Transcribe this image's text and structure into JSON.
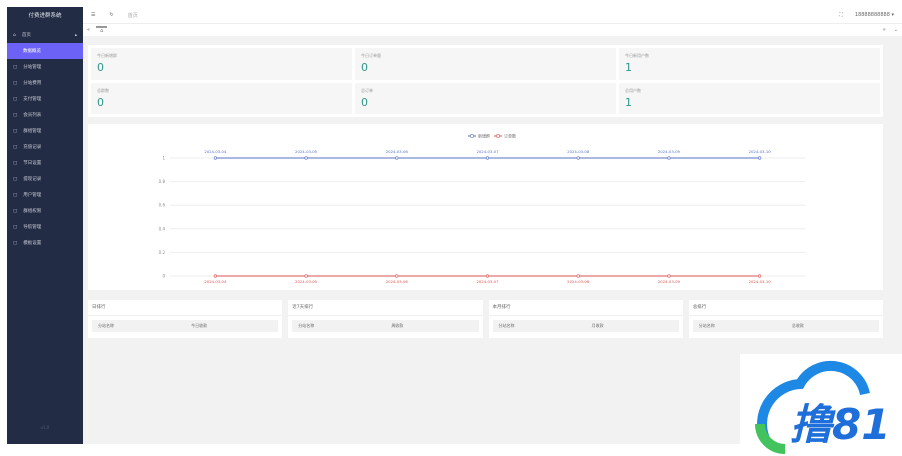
{
  "sidebar": {
    "title": "付费进群系统",
    "home": "首页",
    "items": [
      "数据概览",
      "分站管理",
      "分站费用",
      "支付管理",
      "会员列表",
      "群组管理",
      "充值记录",
      "节日设置",
      "提现记录",
      "用户管理",
      "群组权限",
      "导航管理",
      "模板设置"
    ],
    "version": "v1.0"
  },
  "topbar": {
    "breadcrumb": "首页",
    "user": "18888888888"
  },
  "stats": [
    {
      "label": "今日新增群",
      "value": "0"
    },
    {
      "label": "今日订单量",
      "value": "0"
    },
    {
      "label": "今日新用户数",
      "value": "1"
    },
    {
      "label": "总群数",
      "value": "0"
    },
    {
      "label": "总订单",
      "value": "0"
    },
    {
      "label": "总用户数",
      "value": "1"
    }
  ],
  "chart_data": {
    "type": "line",
    "x": [
      "2024-03-04",
      "2024-03-05",
      "2024-03-06",
      "2024-03-07",
      "2024-03-08",
      "2024-03-09",
      "2024-03-10"
    ],
    "series": [
      {
        "name": "新增群",
        "color": "#5470c6",
        "values": [
          1,
          1,
          1,
          1,
          1,
          1,
          1
        ]
      },
      {
        "name": "订单数",
        "color": "#d9534f",
        "values": [
          0,
          0,
          0,
          0,
          0,
          0,
          0
        ]
      }
    ],
    "yticks": [
      "0",
      "0.2",
      "0.4",
      "0.6",
      "0.8",
      "1"
    ],
    "ylim": [
      0,
      1
    ],
    "legend": "top-center"
  },
  "ranks": [
    {
      "title": "日排行",
      "c1": "分站名称",
      "c2": "今日收款"
    },
    {
      "title": "近7天排行",
      "c1": "分站名称",
      "c2": "周收款"
    },
    {
      "title": "本月排行",
      "c1": "分站名称",
      "c2": "月收款"
    },
    {
      "title": "总排行",
      "c1": "分站名称",
      "c2": "总收款"
    }
  ],
  "watermark": "撸81"
}
